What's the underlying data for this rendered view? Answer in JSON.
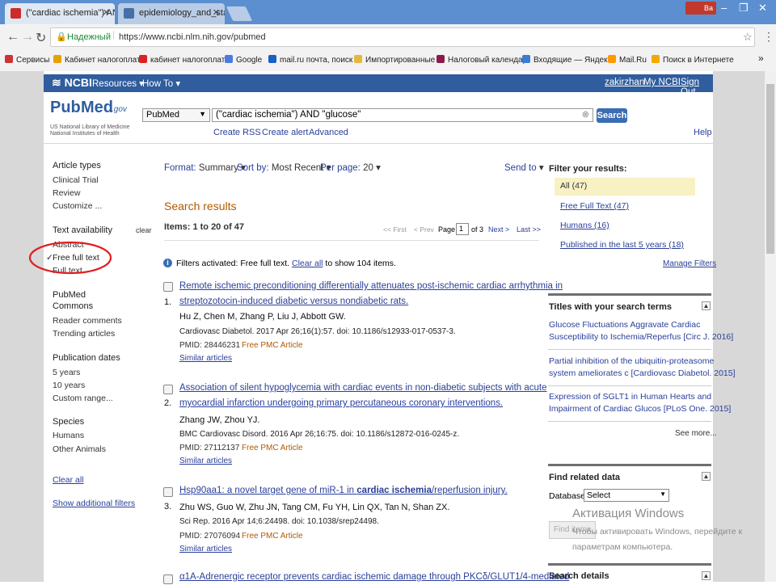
{
  "browser": {
    "tabs": [
      {
        "title": "(\"cardiac ischemia\") AND",
        "favicon_color": "#cc2b2b"
      },
      {
        "title": "epidemiology_and_statis",
        "favicon_color": "#466fa8"
      }
    ],
    "window_user": "Ва",
    "address_secure_label": "Надежный",
    "url": "https://www.ncbi.nlm.nih.gov/pubmed",
    "bookmarks": [
      {
        "label": "Сервисы",
        "color": "#c33"
      },
      {
        "label": "Кабинет налогоплат",
        "color": "#e8a000"
      },
      {
        "label": "кабинет налогоплате",
        "color": "#d22"
      },
      {
        "label": "Google",
        "color": "#4a7be0"
      },
      {
        "label": "mail.ru почта, поиск",
        "color": "#1a60c6"
      },
      {
        "label": "Импортированные",
        "color": "#e5b740"
      },
      {
        "label": "Налоговый календар",
        "color": "#8b1a4a"
      },
      {
        "label": "Входящие — Яндекс",
        "color": "#3a7bd5"
      },
      {
        "label": "Mail.Ru",
        "color": "#ff9900"
      },
      {
        "label": "Поиск в Интернете",
        "color": "#f2a900"
      }
    ]
  },
  "ncbi": {
    "logo": "NCBI",
    "resources": "Resources",
    "howto": "How To",
    "user": "zakirzhan",
    "my_ncbi": "My NCBI",
    "sign_out": "Sign Out"
  },
  "search": {
    "logo_pub": "Pub",
    "logo_med": "Med",
    "logo_gov": ".gov",
    "logo_sub1": "US National Library of Medicine",
    "logo_sub2": "National Institutes of Health",
    "database": "PubMed",
    "query": "(\"cardiac ischemia\") AND \"glucose\"",
    "button": "Search",
    "create_rss": "Create RSS",
    "create_alert": "Create alert",
    "advanced": "Advanced",
    "help": "Help"
  },
  "sidebar": {
    "article_types": "Article types",
    "article_items": [
      "Clinical Trial",
      "Review",
      "Customize ..."
    ],
    "text_availability": "Text availability",
    "clear": "clear",
    "text_items": [
      "Abstract",
      "Free full text",
      "Full text"
    ],
    "checkmark": "✓",
    "pubmed_commons": "PubMed",
    "commons_items": [
      "Commons",
      "Reader comments",
      "Trending articles"
    ],
    "pub_dates": "Publication dates",
    "date_items": [
      "5 years",
      "10 years",
      "Custom range..."
    ],
    "species": "Species",
    "species_items": [
      "Humans",
      "Other Animals"
    ],
    "clear_all": "Clear all",
    "show_additional": "Show additional filters"
  },
  "toolbar": {
    "format_label": "Format:",
    "format_value": "Summary",
    "sort_label": "Sort by:",
    "sort_value": "Most Recent",
    "per_page_label": "Per page:",
    "per_page_value": "20",
    "send_to": "Send to"
  },
  "results": {
    "heading": "Search results",
    "items_count": "Items: 1 to 20 of 47",
    "first": "<< First",
    "prev": "< Prev",
    "page_label": "Page",
    "page_value": "1",
    "of": "of 3",
    "next": "Next >",
    "last": "Last >>",
    "filters_text": "Filters activated: Free full text.",
    "clear_all": "Clear all",
    "filters_suffix": "to show 104 items.",
    "items": [
      {
        "num": "1.",
        "title1": "Remote ischemic preconditioning differentially attenuates post-ischemic cardiac arrhythmia in",
        "title2": "streptozotocin-induced diabetic versus nondiabetic rats.",
        "authors": "Hu Z, Chen M, Zhang P, Liu J, Abbott GW.",
        "source": "Cardiovasc Diabetol. 2017 Apr 26;16(1):57. doi: 10.1186/s12933-017-0537-3.",
        "pmid": "PMID: 28446231",
        "free": "Free PMC Article",
        "similar": "Similar articles"
      },
      {
        "num": "2.",
        "title1": "Association of silent hypoglycemia with cardiac events in non-diabetic subjects with acute",
        "title2": "myocardial infarction undergoing primary percutaneous coronary interventions.",
        "authors": "Zhang JW, Zhou YJ.",
        "source": "BMC Cardiovasc Disord. 2016 Apr 26;16:75. doi: 10.1186/s12872-016-0245-z.",
        "pmid": "PMID: 27112137",
        "free": "Free PMC Article",
        "similar": "Similar articles"
      },
      {
        "num": "3.",
        "title_pre": "Hsp90aa1: a novel target gene of miR-1 in ",
        "title_bold": "cardiac ischemia",
        "title_post": "/reperfusion injury.",
        "authors": "Zhu WS, Guo W, Zhu JN, Tang CM, Fu YH, Lin QX, Tan N, Shan ZX.",
        "source": "Sci Rep. 2016 Apr 14;6:24498. doi: 10.1038/srep24498.",
        "pmid": "PMID: 27076094",
        "free": "Free PMC Article",
        "similar": "Similar articles"
      },
      {
        "title1": "α1A-Adrenergic receptor prevents cardiac ischemic damage through PKCδ/GLUT1/4-mediated"
      }
    ]
  },
  "right": {
    "filter_title": "Filter your results:",
    "filters": [
      "All (47)",
      "Free Full Text (47)",
      "Humans (16)",
      "Published in the last 5 years (18)"
    ],
    "manage_filters": "Manage Filters",
    "titles_box": "Titles with your search terms",
    "title_items": [
      {
        "l1": "Glucose Fluctuations Aggravate Cardiac",
        "l2": "Susceptibility to Ischemia/Reperfus [Circ J. 2016]"
      },
      {
        "l1": "Partial inhibition of the ubiquitin-proteasome",
        "l2": "system ameliorates c [Cardiovasc Diabetol. 2015]"
      },
      {
        "l1": "Expression of SGLT1 in Human Hearts and",
        "l2": "Impairment of Cardiac Glucos [PLoS One. 2015]"
      }
    ],
    "see_more": "See more...",
    "related_title": "Find related data",
    "database_label": "Database:",
    "database_value": "Select",
    "find_items": "Find items",
    "search_details": "Search details"
  },
  "watermark": {
    "line1": "Активация Windows",
    "line2": "Чтобы активировать Windows, перейдите к",
    "line3": "параметрам компьютера."
  }
}
